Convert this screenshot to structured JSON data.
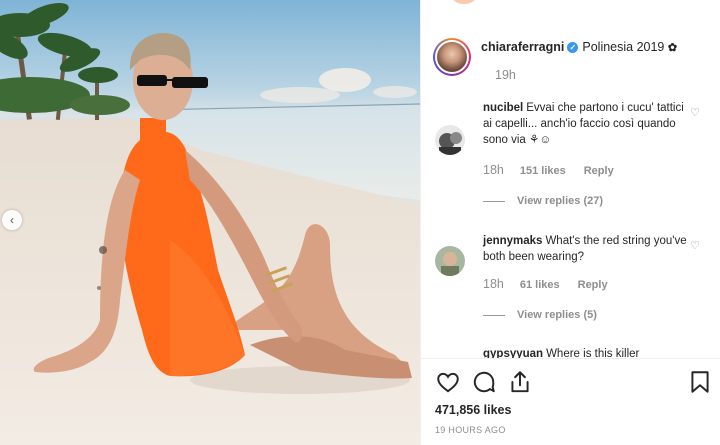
{
  "post": {
    "username": "chiaraferragni",
    "location": "Polinesia 2019",
    "location_icon": "flower-icon",
    "time": "19h"
  },
  "comments": [
    {
      "username": "nucibel",
      "text": "Evvai che partono i cucu' tattici ai capelli... anch'io faccio così quando sono via ⚘☺",
      "age": "18h",
      "likes": "151 likes",
      "reply": "Reply",
      "view_replies": "View replies (27)"
    },
    {
      "username": "jennymaks",
      "text": "What's the red string you've both been wearing?",
      "age": "18h",
      "likes": "61 likes",
      "reply": "Reply",
      "view_replies": "View replies (5)"
    },
    {
      "username": "gypsyyuan",
      "text": "Where is this killer"
    }
  ],
  "footer": {
    "likes": "471,856 likes",
    "posted": "19 HOURS AGO"
  },
  "colors": {
    "dress": "#ff6a1a",
    "verified": "#3897f0",
    "muted_text": "#8e8e8e"
  }
}
